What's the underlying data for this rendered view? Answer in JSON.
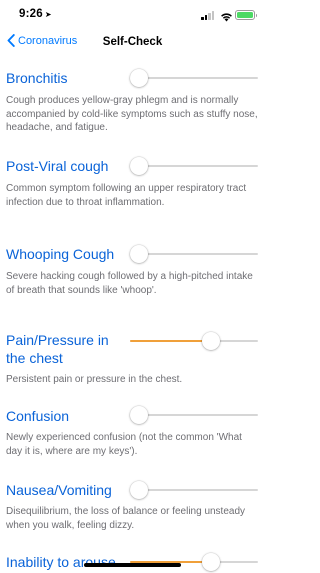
{
  "status_bar": {
    "time": "9:26",
    "location_arrow": "➤"
  },
  "nav": {
    "back_label": "Coronavirus",
    "title": "Self-Check"
  },
  "accent_color": "#007aff",
  "slider_fill_color": "#f0a03a",
  "symptoms": [
    {
      "title": "Bronchitis",
      "description": "Cough produces yellow-gray phlegm and is normally accompanied by cold-like symptoms such as stuffy nose, headache, and fatigue.",
      "level": 0
    },
    {
      "title": "Post-Viral cough",
      "description": "Common symptom following an upper respiratory tract infection due to throat inflammation.",
      "level": 0
    },
    {
      "title": "Whooping Cough",
      "description": "Severe hacking cough followed by a high-pitched intake of breath that sounds like 'whoop'.",
      "level": 0
    },
    {
      "title": "Pain/Pressure in the chest",
      "description": "Persistent pain or pressure in the chest.",
      "level": 0.65
    },
    {
      "title": "Confusion",
      "description": "Newly experienced confusion (not the common 'What day it is, where are my keys').",
      "level": 0
    },
    {
      "title": "Nausea/Vomiting",
      "description": "Disequilibrium, the loss of balance or feeling unsteady when you walk, feeling dizzy.",
      "level": 0
    },
    {
      "title": "Inability to arouse",
      "description": "",
      "level": 0.65
    }
  ]
}
